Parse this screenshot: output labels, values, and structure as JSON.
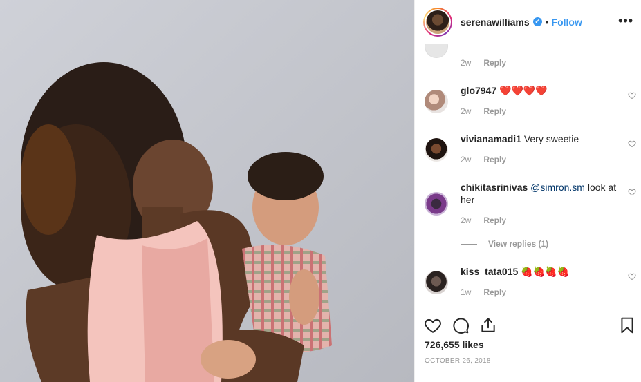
{
  "post": {
    "username": "serenawilliams",
    "verified_mark": "✓",
    "separator": "•",
    "follow_label": "Follow",
    "more_label": "•••"
  },
  "comments": [
    {
      "user": "",
      "text": "",
      "time": "2w",
      "reply": "Reply"
    },
    {
      "user": "glo7947",
      "text": "❤️❤️❤️❤️",
      "time": "2w",
      "reply": "Reply"
    },
    {
      "user": "vivianamadi1",
      "text": "Very sweetie",
      "time": "2w",
      "reply": "Reply"
    },
    {
      "user": "chikitasrinivas",
      "mention": "@simron.sm",
      "text": "look at her",
      "time": "2w",
      "reply": "Reply",
      "view_replies": "View replies (1)"
    },
    {
      "user": "kiss_tata015",
      "text": "🍓🍓🍓🍓",
      "time": "1w",
      "reply": "Reply"
    }
  ],
  "footer": {
    "likes": "726,655 likes",
    "date": "OCTOBER 26, 2018"
  },
  "icons": {
    "like": "heart-icon",
    "comment": "comment-bubble-icon",
    "share": "share-icon",
    "save": "bookmark-icon",
    "more": "more-options-icon"
  },
  "colors": {
    "accent": "#3897f0",
    "heart": "#e0393e",
    "muted": "#999999",
    "text": "#262626"
  }
}
